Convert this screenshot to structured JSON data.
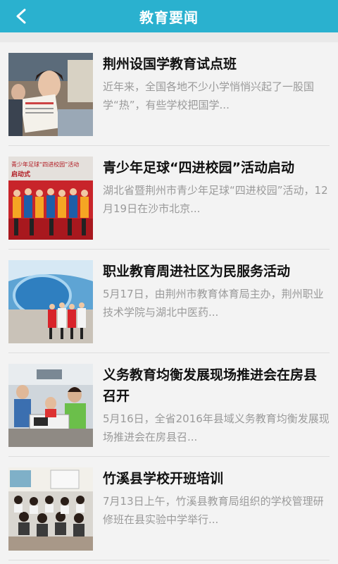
{
  "header": {
    "title": "教育要闻",
    "back_icon": "chevron-left-icon"
  },
  "news": [
    {
      "title": "荆州设国学教育试点班",
      "summary": "近年来，全国各地不少小学悄悄兴起了一股国学“热”，有些学校把国学..."
    },
    {
      "title": "青少年足球“四进校园”活动启动",
      "summary": "湖北省暨荆州市青少年足球“四进校园”活动，12月19日在沙市北京..."
    },
    {
      "title": "职业教育周进社区为民服务活动",
      "summary": "5月17日，由荆州市教育体育局主办，荆州职业技术学院与湖北中医药..."
    },
    {
      "title": "义务教育均衡发展现场推进会在房县召开",
      "summary": "5月16日，全省2016年县域义务教育均衡发展现场推进会在房县召..."
    },
    {
      "title": "竹溪县学校开班培训",
      "summary": "7月13日上午，竹溪县教育局组织的学校管理研修班在县实验中学举行..."
    }
  ],
  "thumb_texts": {
    "football_banner": "青少年足球“四进校园”活动",
    "football_sub": "启动式"
  },
  "colors": {
    "header": "#2ab1cf",
    "title_text": "#111111",
    "summary_text": "#9a9a9a",
    "divider": "#dedede"
  }
}
